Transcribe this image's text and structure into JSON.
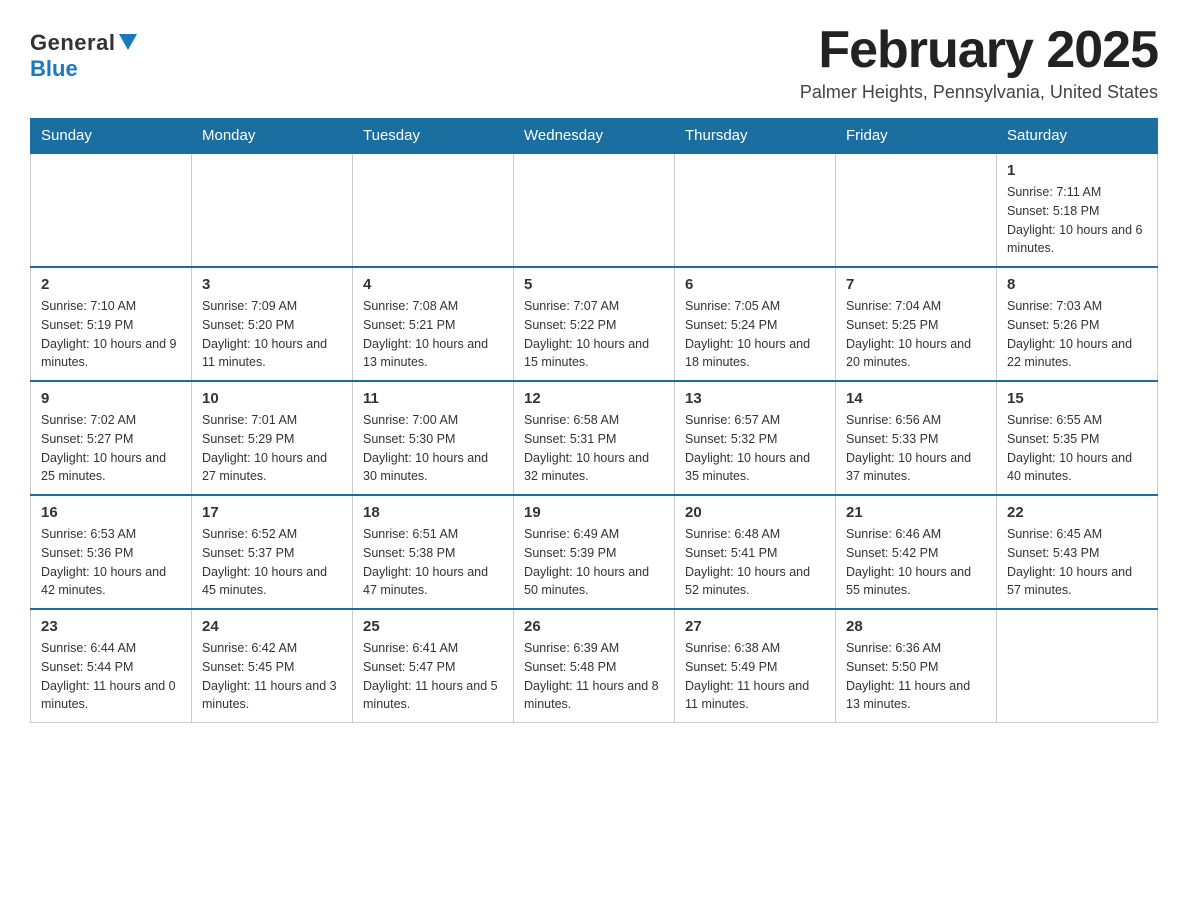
{
  "logo": {
    "general": "General",
    "blue": "Blue"
  },
  "header": {
    "month_year": "February 2025",
    "location": "Palmer Heights, Pennsylvania, United States"
  },
  "days_of_week": [
    "Sunday",
    "Monday",
    "Tuesday",
    "Wednesday",
    "Thursday",
    "Friday",
    "Saturday"
  ],
  "weeks": [
    [
      {
        "day": "",
        "info": ""
      },
      {
        "day": "",
        "info": ""
      },
      {
        "day": "",
        "info": ""
      },
      {
        "day": "",
        "info": ""
      },
      {
        "day": "",
        "info": ""
      },
      {
        "day": "",
        "info": ""
      },
      {
        "day": "1",
        "info": "Sunrise: 7:11 AM\nSunset: 5:18 PM\nDaylight: 10 hours and 6 minutes."
      }
    ],
    [
      {
        "day": "2",
        "info": "Sunrise: 7:10 AM\nSunset: 5:19 PM\nDaylight: 10 hours and 9 minutes."
      },
      {
        "day": "3",
        "info": "Sunrise: 7:09 AM\nSunset: 5:20 PM\nDaylight: 10 hours and 11 minutes."
      },
      {
        "day": "4",
        "info": "Sunrise: 7:08 AM\nSunset: 5:21 PM\nDaylight: 10 hours and 13 minutes."
      },
      {
        "day": "5",
        "info": "Sunrise: 7:07 AM\nSunset: 5:22 PM\nDaylight: 10 hours and 15 minutes."
      },
      {
        "day": "6",
        "info": "Sunrise: 7:05 AM\nSunset: 5:24 PM\nDaylight: 10 hours and 18 minutes."
      },
      {
        "day": "7",
        "info": "Sunrise: 7:04 AM\nSunset: 5:25 PM\nDaylight: 10 hours and 20 minutes."
      },
      {
        "day": "8",
        "info": "Sunrise: 7:03 AM\nSunset: 5:26 PM\nDaylight: 10 hours and 22 minutes."
      }
    ],
    [
      {
        "day": "9",
        "info": "Sunrise: 7:02 AM\nSunset: 5:27 PM\nDaylight: 10 hours and 25 minutes."
      },
      {
        "day": "10",
        "info": "Sunrise: 7:01 AM\nSunset: 5:29 PM\nDaylight: 10 hours and 27 minutes."
      },
      {
        "day": "11",
        "info": "Sunrise: 7:00 AM\nSunset: 5:30 PM\nDaylight: 10 hours and 30 minutes."
      },
      {
        "day": "12",
        "info": "Sunrise: 6:58 AM\nSunset: 5:31 PM\nDaylight: 10 hours and 32 minutes."
      },
      {
        "day": "13",
        "info": "Sunrise: 6:57 AM\nSunset: 5:32 PM\nDaylight: 10 hours and 35 minutes."
      },
      {
        "day": "14",
        "info": "Sunrise: 6:56 AM\nSunset: 5:33 PM\nDaylight: 10 hours and 37 minutes."
      },
      {
        "day": "15",
        "info": "Sunrise: 6:55 AM\nSunset: 5:35 PM\nDaylight: 10 hours and 40 minutes."
      }
    ],
    [
      {
        "day": "16",
        "info": "Sunrise: 6:53 AM\nSunset: 5:36 PM\nDaylight: 10 hours and 42 minutes."
      },
      {
        "day": "17",
        "info": "Sunrise: 6:52 AM\nSunset: 5:37 PM\nDaylight: 10 hours and 45 minutes."
      },
      {
        "day": "18",
        "info": "Sunrise: 6:51 AM\nSunset: 5:38 PM\nDaylight: 10 hours and 47 minutes."
      },
      {
        "day": "19",
        "info": "Sunrise: 6:49 AM\nSunset: 5:39 PM\nDaylight: 10 hours and 50 minutes."
      },
      {
        "day": "20",
        "info": "Sunrise: 6:48 AM\nSunset: 5:41 PM\nDaylight: 10 hours and 52 minutes."
      },
      {
        "day": "21",
        "info": "Sunrise: 6:46 AM\nSunset: 5:42 PM\nDaylight: 10 hours and 55 minutes."
      },
      {
        "day": "22",
        "info": "Sunrise: 6:45 AM\nSunset: 5:43 PM\nDaylight: 10 hours and 57 minutes."
      }
    ],
    [
      {
        "day": "23",
        "info": "Sunrise: 6:44 AM\nSunset: 5:44 PM\nDaylight: 11 hours and 0 minutes."
      },
      {
        "day": "24",
        "info": "Sunrise: 6:42 AM\nSunset: 5:45 PM\nDaylight: 11 hours and 3 minutes."
      },
      {
        "day": "25",
        "info": "Sunrise: 6:41 AM\nSunset: 5:47 PM\nDaylight: 11 hours and 5 minutes."
      },
      {
        "day": "26",
        "info": "Sunrise: 6:39 AM\nSunset: 5:48 PM\nDaylight: 11 hours and 8 minutes."
      },
      {
        "day": "27",
        "info": "Sunrise: 6:38 AM\nSunset: 5:49 PM\nDaylight: 11 hours and 11 minutes."
      },
      {
        "day": "28",
        "info": "Sunrise: 6:36 AM\nSunset: 5:50 PM\nDaylight: 11 hours and 13 minutes."
      },
      {
        "day": "",
        "info": ""
      }
    ]
  ]
}
